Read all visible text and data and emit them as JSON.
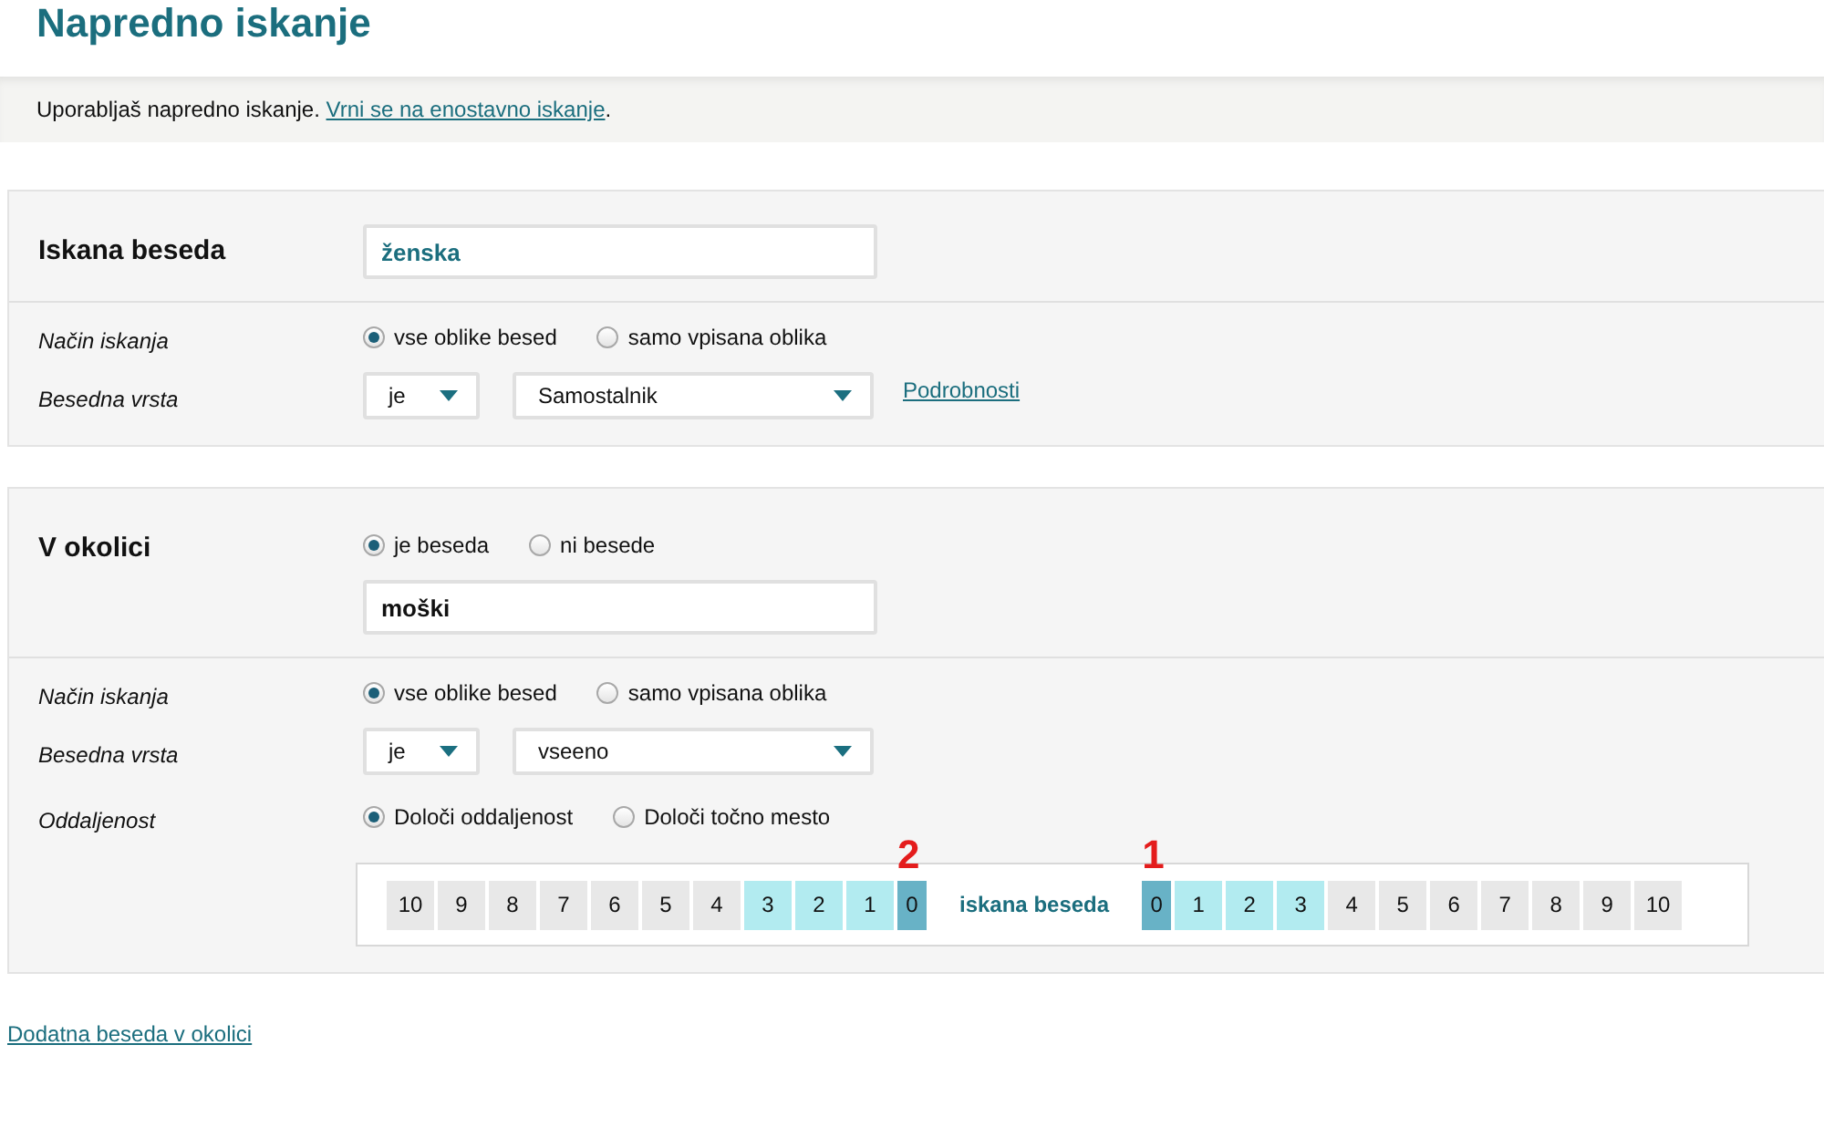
{
  "page_title": "Napredno iskanje",
  "notice": {
    "text": "Uporabljaš napredno iskanje. ",
    "link": "Vrni se na enostavno iskanje",
    "trailing": "."
  },
  "search_panel": {
    "heading": "Iskana beseda",
    "input": {
      "value": "ženska"
    },
    "rows": [
      {
        "kind": "radios",
        "label": "Način iskanja",
        "options": [
          {
            "label": "vse oblike besed",
            "selected": true
          },
          {
            "label": "samo vpisana oblika",
            "selected": false
          }
        ]
      },
      {
        "kind": "selects",
        "label": "Besedna vrsta",
        "selects": [
          {
            "value": "je"
          },
          {
            "value": "Samostalnik"
          }
        ],
        "link": "Podrobnosti"
      }
    ]
  },
  "context_panel": {
    "heading": "V okolici",
    "options": [
      {
        "label": "je beseda",
        "selected": true
      },
      {
        "label": "ni besede",
        "selected": false
      }
    ],
    "input": {
      "value": "moški"
    },
    "rows": [
      {
        "kind": "radios",
        "label": "Način iskanja",
        "options": [
          {
            "label": "vse oblike besed",
            "selected": true
          },
          {
            "label": "samo vpisana oblika",
            "selected": false
          }
        ]
      },
      {
        "kind": "selects",
        "label": "Besedna vrsta",
        "selects": [
          {
            "value": "je"
          },
          {
            "value": "vseeno"
          }
        ]
      },
      {
        "kind": "distance",
        "label": "Oddaljenost",
        "options": [
          {
            "label": "Določi oddaljenost",
            "selected": true
          },
          {
            "label": "Določi točno mesto",
            "selected": false
          }
        ],
        "left_cells": [
          {
            "label": "10",
            "kind": "range",
            "selected": false
          },
          {
            "label": "9",
            "kind": "range",
            "selected": false
          },
          {
            "label": "8",
            "kind": "range",
            "selected": false
          },
          {
            "label": "7",
            "kind": "range",
            "selected": false
          },
          {
            "label": "6",
            "kind": "range",
            "selected": false
          },
          {
            "label": "5",
            "kind": "range",
            "selected": false
          },
          {
            "label": "4",
            "kind": "range",
            "selected": false
          },
          {
            "label": "3",
            "kind": "range",
            "selected": true
          },
          {
            "label": "2",
            "kind": "range",
            "selected": true
          },
          {
            "label": "1",
            "kind": "range",
            "selected": true
          },
          {
            "label": "0",
            "kind": "origin",
            "annotation": "2"
          }
        ],
        "center_label": "iskana beseda",
        "right_cells": [
          {
            "label": "0",
            "kind": "origin",
            "annotation": "1"
          },
          {
            "label": "1",
            "kind": "range",
            "selected": true
          },
          {
            "label": "2",
            "kind": "range",
            "selected": true
          },
          {
            "label": "3",
            "kind": "range",
            "selected": true
          },
          {
            "label": "4",
            "kind": "range",
            "selected": false
          },
          {
            "label": "5",
            "kind": "range",
            "selected": false
          },
          {
            "label": "6",
            "kind": "range",
            "selected": false
          },
          {
            "label": "7",
            "kind": "range",
            "selected": false
          },
          {
            "label": "8",
            "kind": "range",
            "selected": false
          },
          {
            "label": "9",
            "kind": "range",
            "selected": false
          },
          {
            "label": "10",
            "kind": "range",
            "selected": false
          }
        ]
      }
    ]
  },
  "add_link": "Dodatna beseda v okolici"
}
